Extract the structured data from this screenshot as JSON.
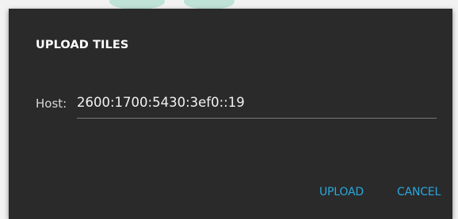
{
  "dialog": {
    "title": "UPLOAD TILES",
    "host_label": "Host:",
    "host_value": "2600:1700:5430:3ef0::19"
  },
  "actions": {
    "upload_label": "UPLOAD",
    "cancel_label": "CANCEL"
  },
  "colors": {
    "dialog_background": "#2a2a2a",
    "accent": "#29a8dd",
    "title_text": "#ffffff",
    "backdrop": "#f2f2f2"
  }
}
